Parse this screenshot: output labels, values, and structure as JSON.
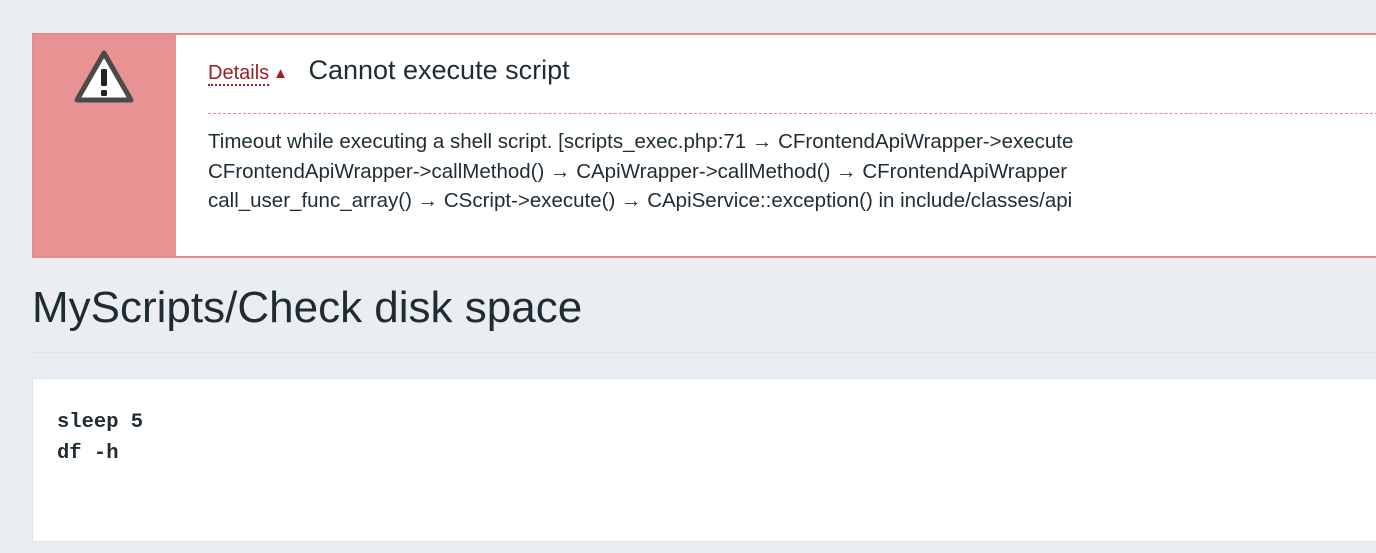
{
  "error_message": {
    "details_label": "Details",
    "details_arrow": "▲",
    "title": "Cannot execute script",
    "detail_lines": [
      "Timeout while executing a shell script. [scripts_exec.php:71 → CFrontendApiWrapper->execute",
      "CFrontendApiWrapper->callMethod() → CApiWrapper->callMethod() → CFrontendApiWrapper",
      "call_user_func_array() → CScript->execute() → CApiService::exception() in include/classes/api"
    ],
    "colors": {
      "icon_background": "#e89393",
      "border": "#e58d8d",
      "details_link": "#9c2020"
    },
    "icon": "warning-triangle-icon"
  },
  "page_title": "MyScripts/Check disk space",
  "script_lines": [
    "sleep 5",
    "df -h"
  ]
}
